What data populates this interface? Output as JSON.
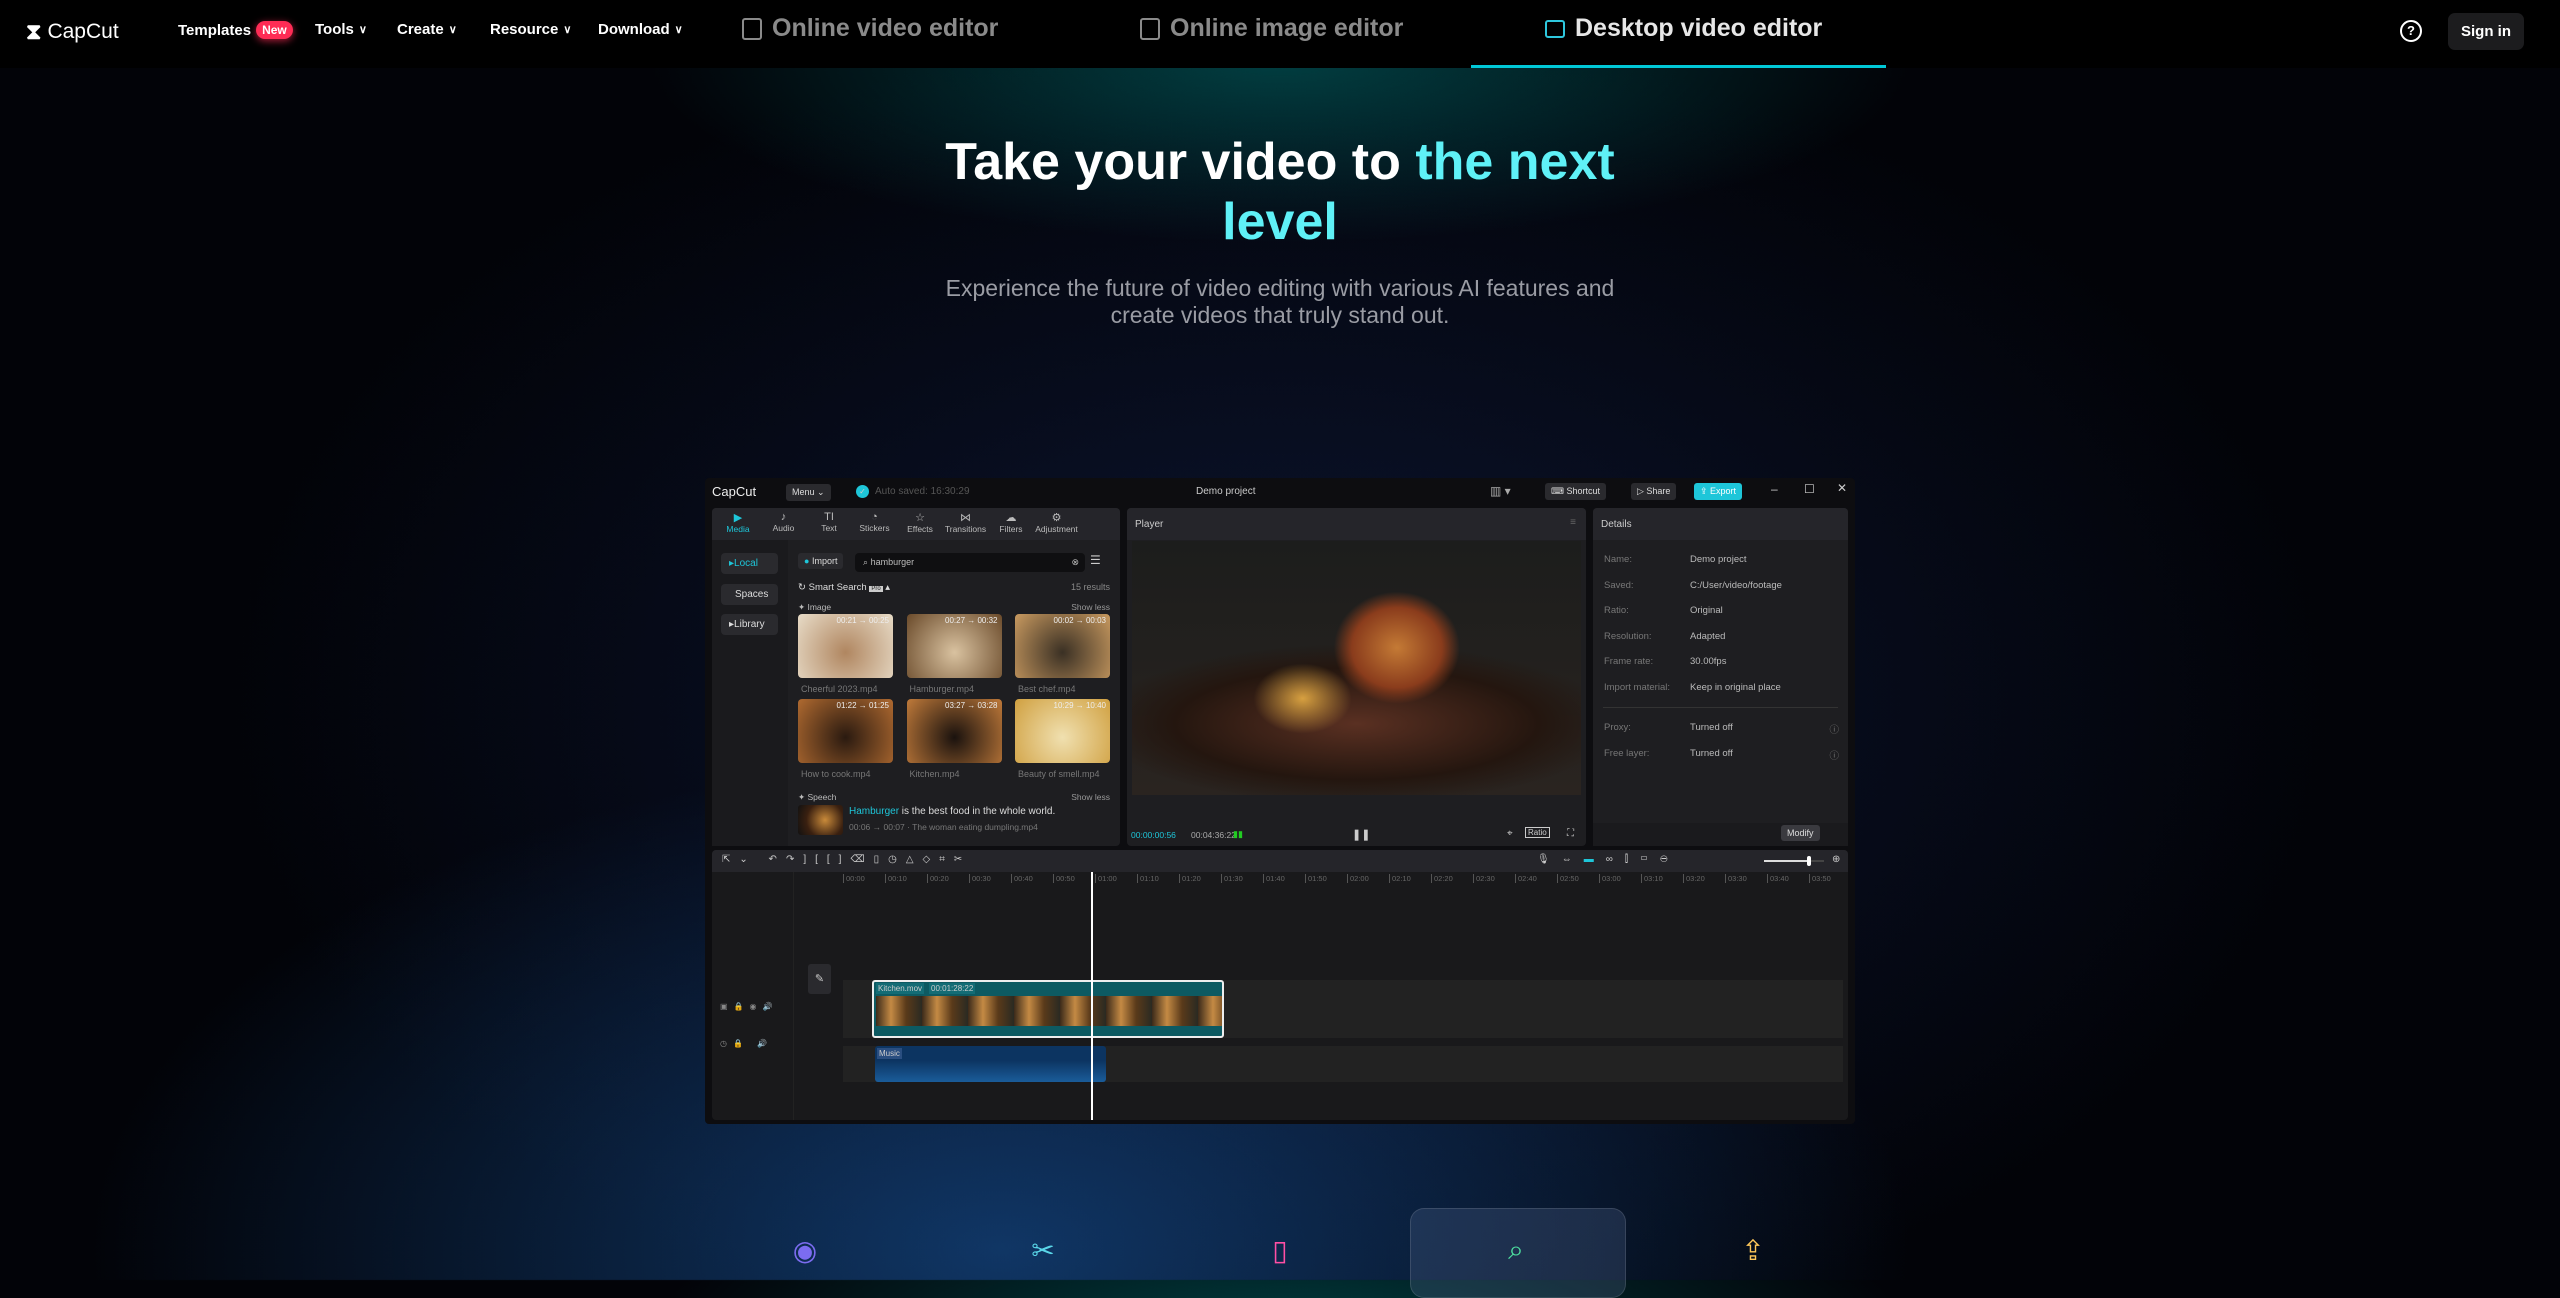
{
  "nav": {
    "logo": "CapCut",
    "items": [
      {
        "label": "Templates",
        "badge": "New"
      },
      {
        "label": "Tools"
      },
      {
        "label": "Create"
      },
      {
        "label": "Resource"
      },
      {
        "label": "Download"
      }
    ],
    "tabs": [
      {
        "label": "Online video editor",
        "icon": "film-icon"
      },
      {
        "label": "Online image editor",
        "icon": "image-icon"
      },
      {
        "label": "Desktop video editor",
        "icon": "monitor-icon",
        "active": true
      }
    ],
    "help": "?",
    "sign_in": "Sign in",
    "accent": "#00c8d7"
  },
  "hero": {
    "title_white": "Take your video to ",
    "title_cyan": "the next",
    "title_line2": "level",
    "subtitle_line1": "Experience the future of video editing with various AI features and",
    "subtitle_line2": "create videos that truly stand out."
  },
  "app": {
    "logo": "CapCut",
    "menu": "Menu",
    "autosaved": "Auto saved: 16:30:29",
    "project": "Demo project",
    "shortcut": "Shortcut",
    "share": "Share",
    "export": "Export",
    "tools": [
      "Media",
      "Audio",
      "Text",
      "Stickers",
      "Effects",
      "Transitions",
      "Filters",
      "Adjustment"
    ],
    "side": [
      "Local",
      "Spaces",
      "Library"
    ],
    "import": "Import",
    "search": "hamburger",
    "smart_search": "Smart Search",
    "pro": "Pro",
    "results": "15 results",
    "image_label": "Image",
    "show_less": "Show less",
    "thumbs": [
      {
        "range": "00:21 → 00:25",
        "name": "Cheerful 2023.mp4"
      },
      {
        "range": "00:27 → 00:32",
        "name": "Hamburger.mp4"
      },
      {
        "range": "00:02 → 00:03",
        "name": "Best chef.mp4"
      },
      {
        "range": "01:22 → 01:25",
        "name": "How to cook.mp4"
      },
      {
        "range": "03:27 → 03:28",
        "name": "Kitchen.mp4"
      },
      {
        "range": "10:29 → 10:40",
        "name": "Beauty of smell.mp4"
      }
    ],
    "speech_label": "Speech",
    "speech_hl": "Hamburger",
    "speech_text": " is the best food in the whole world.",
    "speech_meta": "00:06 → 00:07  ·  The woman eating dumpling.mp4",
    "player": {
      "title": "Player",
      "current": "00:00:00:56",
      "total": "00:04:36:22",
      "ratio": "Ratio"
    },
    "details": {
      "title": "Details",
      "rows": [
        {
          "label": "Name:",
          "value": "Demo project"
        },
        {
          "label": "Saved:",
          "value": "C:/User/video/footage"
        },
        {
          "label": "Ratio:",
          "value": "Original"
        },
        {
          "label": "Resolution:",
          "value": "Adapted"
        },
        {
          "label": "Frame rate:",
          "value": "30.00fps"
        },
        {
          "label": "Import material:",
          "value": "Keep in original place"
        }
      ],
      "rows2": [
        {
          "label": "Proxy:",
          "value": "Turned off"
        },
        {
          "label": "Free layer:",
          "value": "Turned off"
        }
      ],
      "modify": "Modify"
    },
    "timeline": {
      "ruler": [
        "00:00",
        "00:10",
        "00:20",
        "00:30",
        "00:40",
        "00:50",
        "01:00",
        "01:10",
        "01:20",
        "01:30",
        "01:40",
        "01:50",
        "02:00",
        "02:10",
        "02:20",
        "02:30",
        "02:40",
        "02:50",
        "03:00",
        "03:10",
        "03:20",
        "03:30",
        "03:40",
        "03:50"
      ],
      "clip_name": "Kitchen.mov",
      "clip_duration": "00:01:28:22",
      "music": "Music",
      "zoom_level": 0.75
    }
  },
  "features": [
    {
      "icon": "voice-icon",
      "color": "#7b6cf0"
    },
    {
      "icon": "video-cut-icon",
      "color": "#5ad6e8"
    },
    {
      "icon": "frame-icon",
      "color": "#ff4fa5"
    },
    {
      "icon": "folder-search-icon",
      "color": "#4ee0a0",
      "active": true
    },
    {
      "icon": "laptop-upload-icon",
      "color": "#ffc85a"
    }
  ]
}
